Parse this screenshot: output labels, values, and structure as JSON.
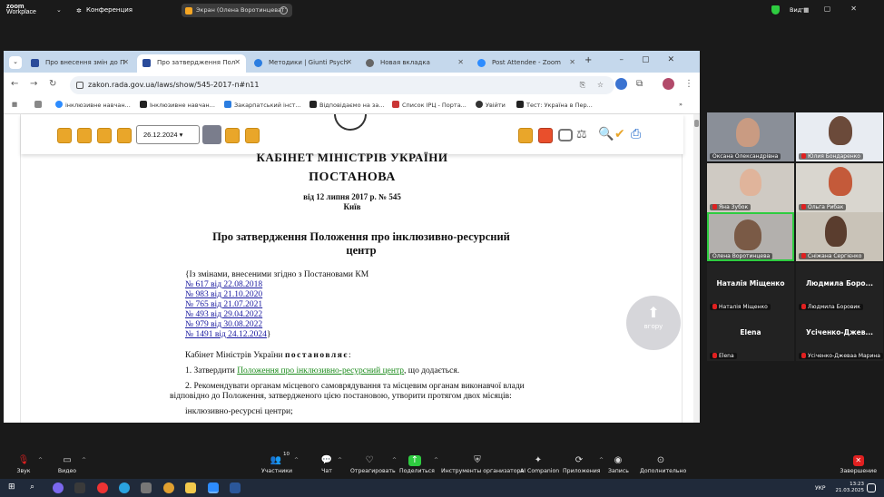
{
  "zoom": {
    "logo_line1": "zoom",
    "logo_line2": "Workplace",
    "conference": "Конференция",
    "share_label": "Экран (Олена Воротинцева)",
    "view_label": "Вид",
    "accent": "#2ecc40"
  },
  "browser": {
    "tabs": [
      {
        "label": "Про внесення змін до П",
        "active": false
      },
      {
        "label": "Про затвердження Пол",
        "active": true
      },
      {
        "label": "Методики | Giunti Psych",
        "active": false
      },
      {
        "label": "Новая вкладка",
        "active": false
      },
      {
        "label": "Post Attendee - Zoom",
        "active": false
      }
    ],
    "url": "zakon.rada.gov.ua/laws/show/545-2017-п#n11",
    "bookmarks": [
      "інклюзивне навчан...",
      "Інклюзивне навчан...",
      "Закарпатський інст...",
      "Відповідаємо на за...",
      "Список ІРЦ - Порта...",
      "Увійти",
      "Тест: Україна в Пер..."
    ]
  },
  "doc": {
    "date_select": "26.12.2024",
    "header1": "КАБІНЕТ МІНІСТРІВ УКРАЇНИ",
    "header2": "ПОСТАНОВА",
    "date_line": "від 12 липня 2017 р. № 545",
    "city": "Київ",
    "title_line1": "Про затвердження Положення про інклюзивно-ресурсний",
    "title_line2": "центр",
    "changes_intro": "{Із змінами, внесеними згідно з Постановами КМ",
    "changes": [
      "№ 617 від 22.08.2018",
      "№ 983 від 21.10.2020",
      "№ 765 від 21.07.2021",
      "№ 493 від 29.04.2022",
      "№ 979 від 30.08.2022",
      "№ 1491 від 24.12.2024"
    ],
    "changes_close": "}",
    "p_intro_a": "Кабінет Міністрів України",
    "p_intro_b": "постановляє",
    "p_intro_c": ":",
    "p1_a": "1. Затвердити",
    "p1_link": "Положення про інклюзивно-ресурсний центр",
    "p1_b": ", що додається.",
    "p2_line1": "2. Рекомендувати органам місцевого самоврядування та місцевим органам виконавчої влади",
    "p2_line2": "відповідно до Положення, затвердженого цією постановою, утворити протягом двох місяців:",
    "p3": "інклюзивно-ресурсні центри;",
    "up_label": "вгору"
  },
  "gallery": {
    "tiles": [
      {
        "name": "Оксана Олександрівна",
        "muted": false,
        "video": true
      },
      {
        "name": "Юлия Бондаренко",
        "muted": true,
        "video": true
      },
      {
        "name": "Яна Зубок",
        "muted": true,
        "video": true
      },
      {
        "name": "Ольга Рибак",
        "muted": true,
        "video": true
      },
      {
        "name": "Олена Воротинцева",
        "muted": false,
        "video": true
      },
      {
        "name": "Сніжана Сергієнко",
        "muted": true,
        "video": true
      },
      {
        "big": "Наталія Міщенко",
        "name": "Наталія Міщенко",
        "muted": true,
        "video": false
      },
      {
        "big": "Людмила Боро...",
        "name": "Людмила Боровик",
        "muted": true,
        "video": false
      },
      {
        "big": "Elena",
        "name": "Elena",
        "muted": true,
        "video": false
      },
      {
        "big": "Усіченко-Джев...",
        "name": "Усіченко-Джеваа Марина",
        "muted": true,
        "video": false
      }
    ]
  },
  "controls": {
    "audio": "Звук",
    "video": "Видео",
    "participants": "Участники",
    "participants_count": "10",
    "chat": "Чат",
    "react": "Отреагировать",
    "share": "Поделиться",
    "host_tools": "Инструменты организатора",
    "ai": "AI Companion",
    "apps": "Приложения",
    "record": "Запись",
    "more": "Дополнительно",
    "end": "Завершение"
  },
  "taskbar": {
    "lang": "УКР",
    "time": "13:23",
    "date": "21.03.2025"
  }
}
